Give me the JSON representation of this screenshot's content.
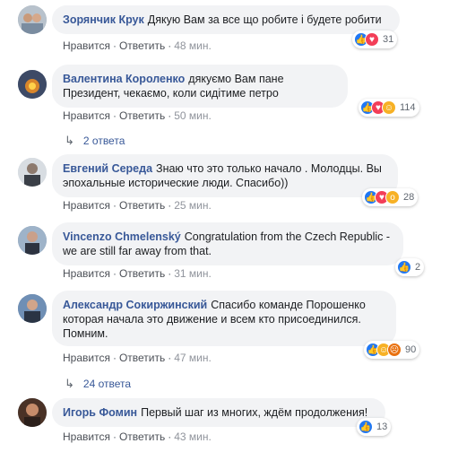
{
  "comments": [
    {
      "author": "Зорянчик Крук",
      "text": "Дякую Вам за все що робите і будете робити",
      "like": "Нравится",
      "reply": "Ответить",
      "time": "48 мин.",
      "reactions": [
        "like",
        "love"
      ],
      "count": "31"
    },
    {
      "author": "Валентина Короленко",
      "text": "дякуємо Вам пане Президент, чекаємо, коли сидітиме петро",
      "like": "Нравится",
      "reply": "Ответить",
      "time": "50 мин.",
      "reactions": [
        "like",
        "love",
        "haha"
      ],
      "count": "114",
      "replies": "2 ответа"
    },
    {
      "author": "Евгений Середа",
      "text": "Знаю что это только начало . Молодцы. Вы эпохальные исторические люди. Спасибо))",
      "like": "Нравится",
      "reply": "Ответить",
      "time": "25 мин.",
      "reactions": [
        "like",
        "love",
        "wow"
      ],
      "count": "28"
    },
    {
      "author": "Vincenzo Chmelenský",
      "text": "Congratulation from the Czech Republic - we are still far away from that.",
      "like": "Нравится",
      "reply": "Ответить",
      "time": "31 мин.",
      "reactions": [
        "like"
      ],
      "count": "2"
    },
    {
      "author": "Александр Сокиржинский",
      "text": "Спасибо команде Порошенко которая начала это движение и всем кто присоединился. Помним.",
      "like": "Нравится",
      "reply": "Ответить",
      "time": "47 мин.",
      "reactions": [
        "like",
        "haha",
        "angry"
      ],
      "count": "90",
      "replies": "24 ответа"
    },
    {
      "author": "Игорь Фомин",
      "text": "Первый шаг из многих, ждём продолжения!",
      "like": "Нравится",
      "reply": "Ответить",
      "time": "43 мин.",
      "reactions": [
        "like"
      ],
      "count": "13"
    }
  ],
  "colors": {
    "author": "#385898",
    "bubble": "#f2f3f5",
    "like_blue": "#2078f4",
    "love_red": "#f33e58",
    "haha_yellow": "#f7b125",
    "angry_orange": "#e9710f"
  }
}
